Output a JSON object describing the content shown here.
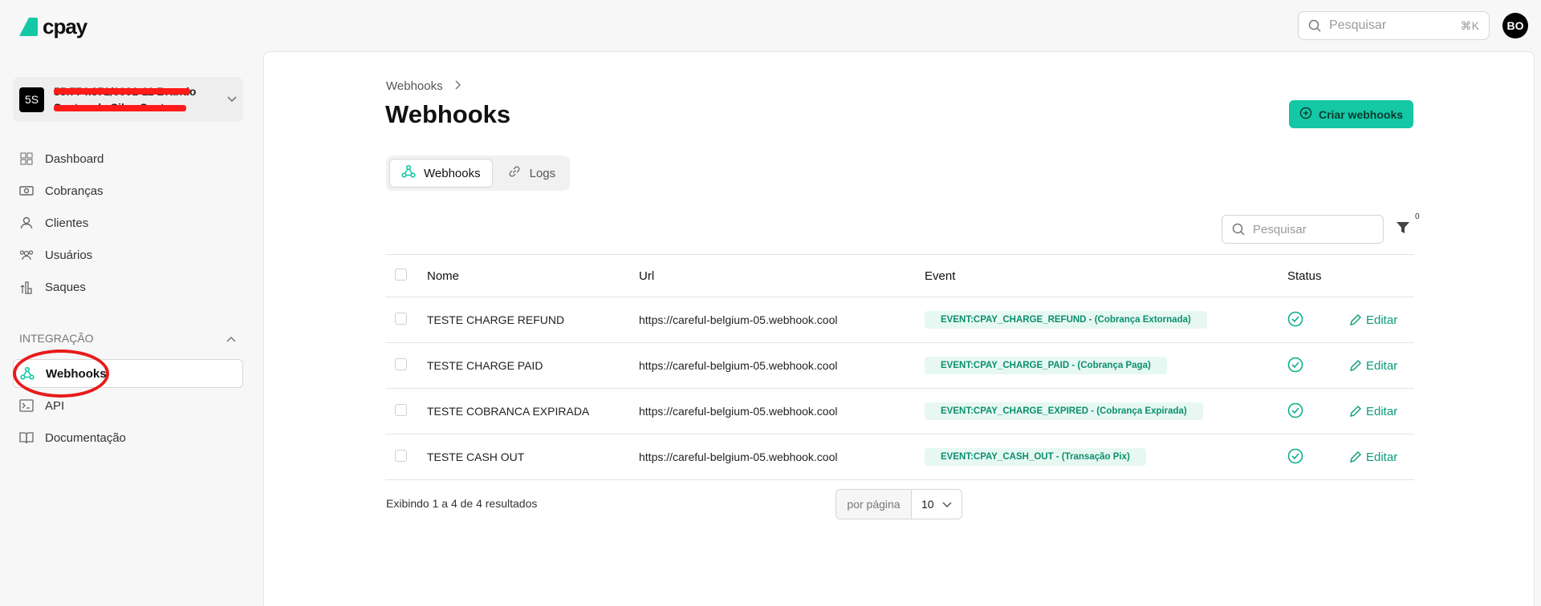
{
  "brand": {
    "name": "cpay"
  },
  "topbar": {
    "search_placeholder": "Pesquisar",
    "shortcut": "⌘K",
    "avatar_initials": "BO"
  },
  "org": {
    "badge": "5S",
    "name": "55.774.371/0001-11 Brando Santos da Silva Santos"
  },
  "nav": {
    "items": [
      {
        "label": "Dashboard"
      },
      {
        "label": "Cobranças"
      },
      {
        "label": "Clientes"
      },
      {
        "label": "Usuários"
      },
      {
        "label": "Saques"
      }
    ],
    "section_label": "INTEGRAÇÃO",
    "integration_items": [
      {
        "label": "Webhooks"
      },
      {
        "label": "API"
      },
      {
        "label": "Documentação"
      }
    ]
  },
  "main": {
    "breadcrumb": "Webhooks",
    "title": "Webhooks",
    "create_button": "Criar webhooks",
    "tabs": [
      {
        "label": "Webhooks"
      },
      {
        "label": "Logs"
      }
    ],
    "search_placeholder": "Pesquisar",
    "filter_count": "0",
    "columns": {
      "name": "Nome",
      "url": "Url",
      "event": "Event",
      "status": "Status"
    },
    "rows": [
      {
        "name": "TESTE CHARGE REFUND",
        "url": "https://careful-belgium-05.webhook.cool",
        "event": "EVENT:CPAY_CHARGE_REFUND - (Cobrança Extornada)",
        "edit": "Editar"
      },
      {
        "name": "TESTE CHARGE PAID",
        "url": "https://careful-belgium-05.webhook.cool",
        "event": "EVENT:CPAY_CHARGE_PAID - (Cobrança Paga)",
        "edit": "Editar"
      },
      {
        "name": "TESTE COBRANCA EXPIRADA",
        "url": "https://careful-belgium-05.webhook.cool",
        "event": "EVENT:CPAY_CHARGE_EXPIRED - (Cobrança Expirada)",
        "edit": "Editar"
      },
      {
        "name": "TESTE CASH OUT",
        "url": "https://careful-belgium-05.webhook.cool",
        "event": "EVENT:CPAY_CASH_OUT - (Transação Pix)",
        "edit": "Editar"
      }
    ],
    "results_text": "Exibindo 1 a 4 de 4 resultados",
    "per_page_label": "por página",
    "per_page_value": "10"
  },
  "colors": {
    "accent": "#14c7a5",
    "event_bg": "#e7f8f3",
    "event_text": "#0b8f6c",
    "annotation_red": "#e81b1b"
  }
}
